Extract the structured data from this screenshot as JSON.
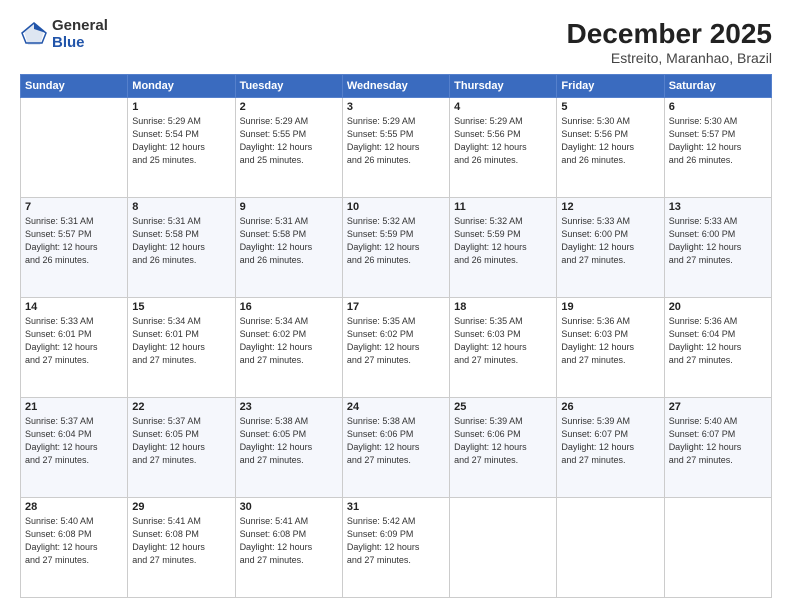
{
  "logo": {
    "general": "General",
    "blue": "Blue"
  },
  "title": "December 2025",
  "subtitle": "Estreito, Maranhao, Brazil",
  "headers": [
    "Sunday",
    "Monday",
    "Tuesday",
    "Wednesday",
    "Thursday",
    "Friday",
    "Saturday"
  ],
  "weeks": [
    [
      {
        "day": "",
        "info": ""
      },
      {
        "day": "1",
        "info": "Sunrise: 5:29 AM\nSunset: 5:54 PM\nDaylight: 12 hours\nand 25 minutes."
      },
      {
        "day": "2",
        "info": "Sunrise: 5:29 AM\nSunset: 5:55 PM\nDaylight: 12 hours\nand 25 minutes."
      },
      {
        "day": "3",
        "info": "Sunrise: 5:29 AM\nSunset: 5:55 PM\nDaylight: 12 hours\nand 26 minutes."
      },
      {
        "day": "4",
        "info": "Sunrise: 5:29 AM\nSunset: 5:56 PM\nDaylight: 12 hours\nand 26 minutes."
      },
      {
        "day": "5",
        "info": "Sunrise: 5:30 AM\nSunset: 5:56 PM\nDaylight: 12 hours\nand 26 minutes."
      },
      {
        "day": "6",
        "info": "Sunrise: 5:30 AM\nSunset: 5:57 PM\nDaylight: 12 hours\nand 26 minutes."
      }
    ],
    [
      {
        "day": "7",
        "info": "Sunrise: 5:31 AM\nSunset: 5:57 PM\nDaylight: 12 hours\nand 26 minutes."
      },
      {
        "day": "8",
        "info": "Sunrise: 5:31 AM\nSunset: 5:58 PM\nDaylight: 12 hours\nand 26 minutes."
      },
      {
        "day": "9",
        "info": "Sunrise: 5:31 AM\nSunset: 5:58 PM\nDaylight: 12 hours\nand 26 minutes."
      },
      {
        "day": "10",
        "info": "Sunrise: 5:32 AM\nSunset: 5:59 PM\nDaylight: 12 hours\nand 26 minutes."
      },
      {
        "day": "11",
        "info": "Sunrise: 5:32 AM\nSunset: 5:59 PM\nDaylight: 12 hours\nand 26 minutes."
      },
      {
        "day": "12",
        "info": "Sunrise: 5:33 AM\nSunset: 6:00 PM\nDaylight: 12 hours\nand 27 minutes."
      },
      {
        "day": "13",
        "info": "Sunrise: 5:33 AM\nSunset: 6:00 PM\nDaylight: 12 hours\nand 27 minutes."
      }
    ],
    [
      {
        "day": "14",
        "info": "Sunrise: 5:33 AM\nSunset: 6:01 PM\nDaylight: 12 hours\nand 27 minutes."
      },
      {
        "day": "15",
        "info": "Sunrise: 5:34 AM\nSunset: 6:01 PM\nDaylight: 12 hours\nand 27 minutes."
      },
      {
        "day": "16",
        "info": "Sunrise: 5:34 AM\nSunset: 6:02 PM\nDaylight: 12 hours\nand 27 minutes."
      },
      {
        "day": "17",
        "info": "Sunrise: 5:35 AM\nSunset: 6:02 PM\nDaylight: 12 hours\nand 27 minutes."
      },
      {
        "day": "18",
        "info": "Sunrise: 5:35 AM\nSunset: 6:03 PM\nDaylight: 12 hours\nand 27 minutes."
      },
      {
        "day": "19",
        "info": "Sunrise: 5:36 AM\nSunset: 6:03 PM\nDaylight: 12 hours\nand 27 minutes."
      },
      {
        "day": "20",
        "info": "Sunrise: 5:36 AM\nSunset: 6:04 PM\nDaylight: 12 hours\nand 27 minutes."
      }
    ],
    [
      {
        "day": "21",
        "info": "Sunrise: 5:37 AM\nSunset: 6:04 PM\nDaylight: 12 hours\nand 27 minutes."
      },
      {
        "day": "22",
        "info": "Sunrise: 5:37 AM\nSunset: 6:05 PM\nDaylight: 12 hours\nand 27 minutes."
      },
      {
        "day": "23",
        "info": "Sunrise: 5:38 AM\nSunset: 6:05 PM\nDaylight: 12 hours\nand 27 minutes."
      },
      {
        "day": "24",
        "info": "Sunrise: 5:38 AM\nSunset: 6:06 PM\nDaylight: 12 hours\nand 27 minutes."
      },
      {
        "day": "25",
        "info": "Sunrise: 5:39 AM\nSunset: 6:06 PM\nDaylight: 12 hours\nand 27 minutes."
      },
      {
        "day": "26",
        "info": "Sunrise: 5:39 AM\nSunset: 6:07 PM\nDaylight: 12 hours\nand 27 minutes."
      },
      {
        "day": "27",
        "info": "Sunrise: 5:40 AM\nSunset: 6:07 PM\nDaylight: 12 hours\nand 27 minutes."
      }
    ],
    [
      {
        "day": "28",
        "info": "Sunrise: 5:40 AM\nSunset: 6:08 PM\nDaylight: 12 hours\nand 27 minutes."
      },
      {
        "day": "29",
        "info": "Sunrise: 5:41 AM\nSunset: 6:08 PM\nDaylight: 12 hours\nand 27 minutes."
      },
      {
        "day": "30",
        "info": "Sunrise: 5:41 AM\nSunset: 6:08 PM\nDaylight: 12 hours\nand 27 minutes."
      },
      {
        "day": "31",
        "info": "Sunrise: 5:42 AM\nSunset: 6:09 PM\nDaylight: 12 hours\nand 27 minutes."
      },
      {
        "day": "",
        "info": ""
      },
      {
        "day": "",
        "info": ""
      },
      {
        "day": "",
        "info": ""
      }
    ]
  ]
}
